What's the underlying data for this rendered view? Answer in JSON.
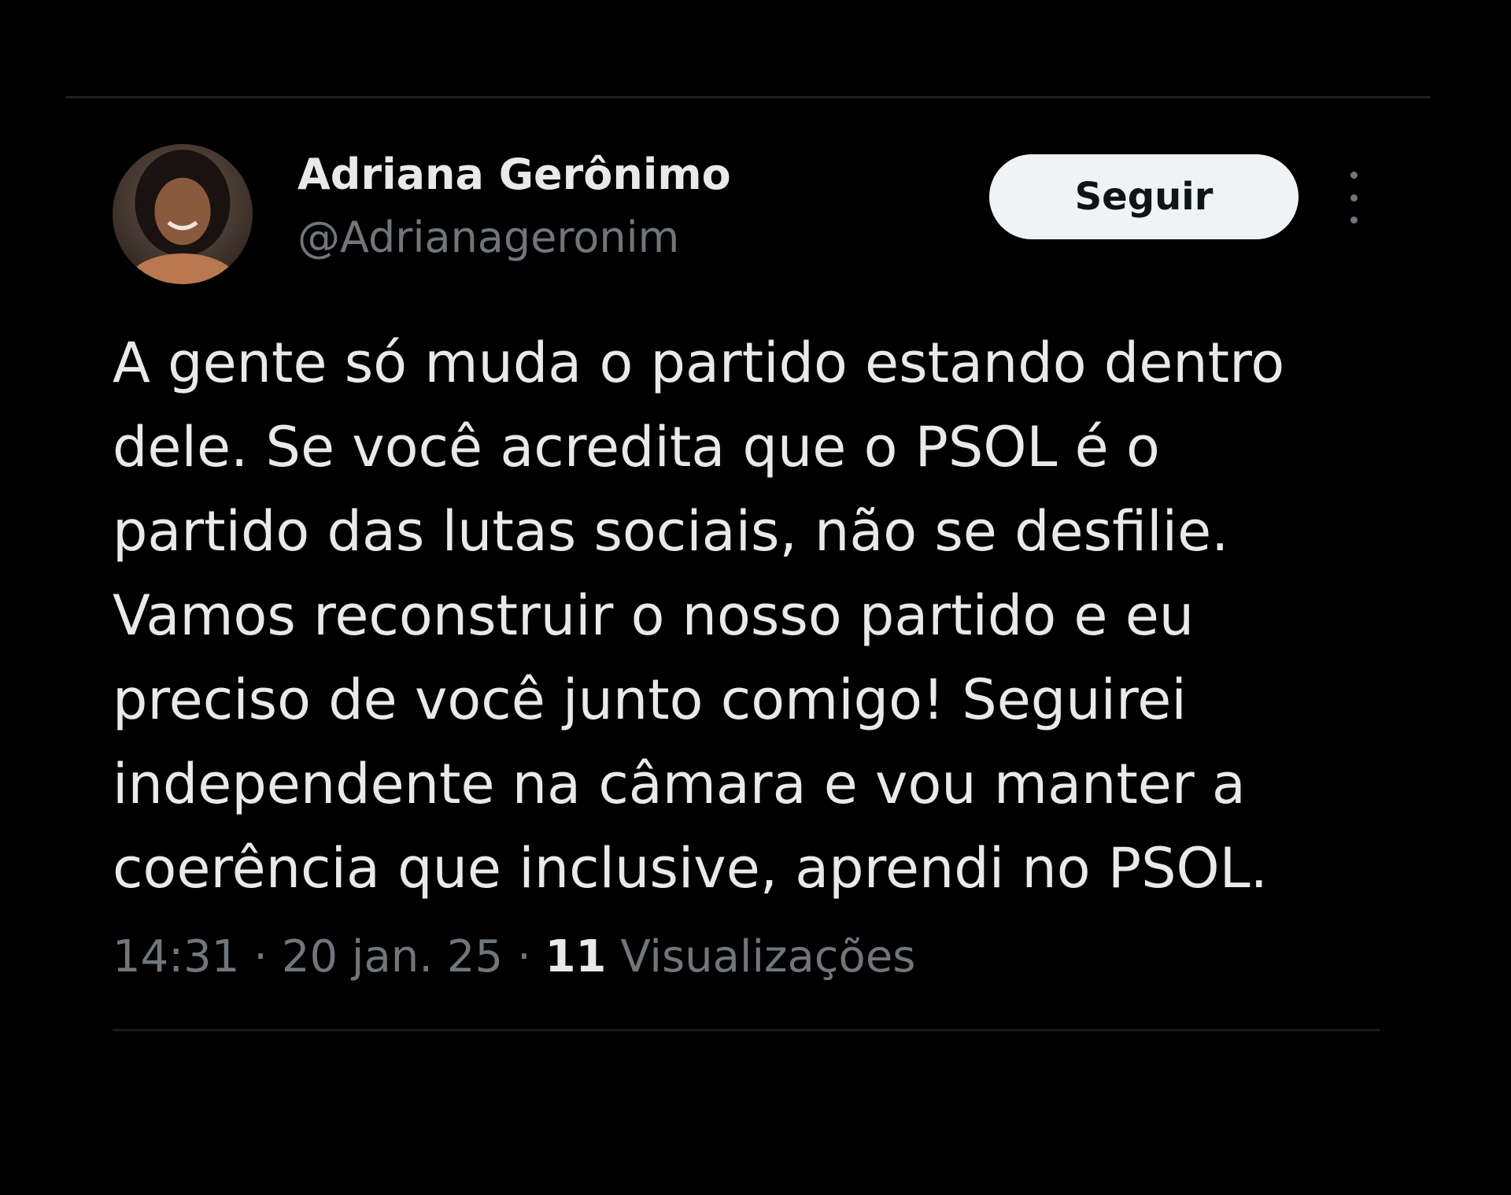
{
  "tweet": {
    "author": {
      "display_name": "Adriana Gerônimo",
      "handle": "@Adrianageronim",
      "avatar_icon": "profile-photo"
    },
    "follow_label": "Seguir",
    "more_icon": "more-vertical-icon",
    "text": "A gente só muda o partido estando dentro\ndele. Se você acredita que o PSOL é o\npartido das lutas sociais, não se desfilie.\nVamos reconstruir o nosso partido e eu\npreciso de você junto comigo! Seguirei\nindependente na câmara e vou manter a\ncoerência que inclusive, aprendi no PSOL.",
    "time": "14:31",
    "date": "20 jan. 25",
    "separator": "·",
    "views_count": "11",
    "views_label": "Visualizações"
  },
  "colors": {
    "background": "#000000",
    "primary_text": "#e7e9ea",
    "secondary_text": "#71767b",
    "button_bg": "#eff3f4",
    "button_text": "#0f1419"
  }
}
